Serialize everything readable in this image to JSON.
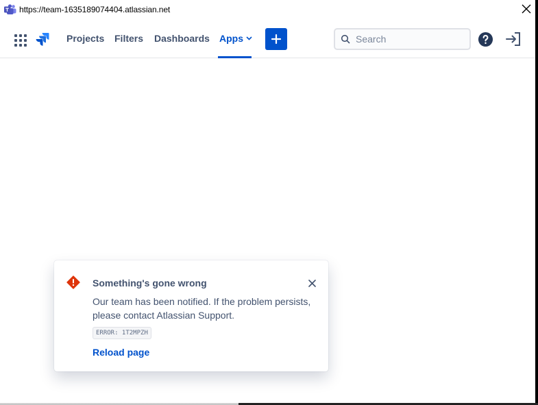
{
  "window": {
    "url": "https://team-1635189074404.atlassian.net",
    "app_icon": "teams-icon"
  },
  "nav": {
    "app_switcher_icon": "app-grid-icon",
    "logo_icon": "jira-logo-icon",
    "items": [
      {
        "label": "Projects"
      },
      {
        "label": "Filters"
      },
      {
        "label": "Dashboards"
      },
      {
        "label": "Apps",
        "active": true,
        "has_dropdown": true
      }
    ],
    "create_icon": "plus-icon",
    "search": {
      "placeholder": "Search",
      "value": ""
    },
    "help_icon": "question-circle-icon",
    "login_icon": "sign-in-icon",
    "accent": "#0052cc"
  },
  "flag": {
    "icon": "error-diamond-icon",
    "icon_color": "#de350b",
    "title": "Something's gone wrong",
    "description_line1": "Our team has been notified. If the problem persists,",
    "description_line2": "please contact Atlassian Support.",
    "error_code": "ERROR: 1T2MPZH",
    "action": "Reload page"
  }
}
